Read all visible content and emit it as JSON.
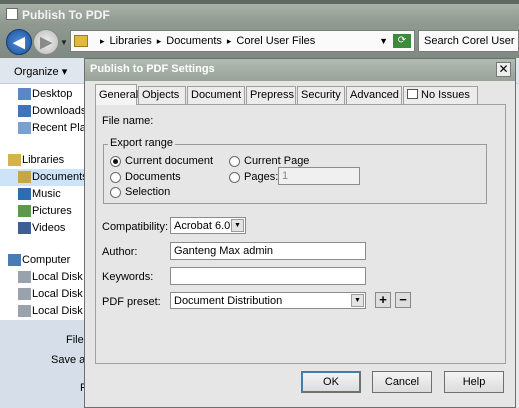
{
  "outer_window": {
    "title": "Publish To PDF",
    "address_path": [
      "Libraries",
      "Documents",
      "Corel User Files"
    ],
    "search_placeholder": "Search Corel User Files",
    "organize_label": "Organize",
    "nav_items": [
      {
        "label": "Desktop",
        "icon": "desktop-icon",
        "color": "#5b87c6"
      },
      {
        "label": "Downloads",
        "icon": "downloads-icon",
        "color": "#3f74b8"
      },
      {
        "label": "Recent Places",
        "icon": "recent-places-icon",
        "color": "#7aa0cf"
      },
      {
        "label": "Libraries",
        "icon": "libraries-icon",
        "color": "#d6b34a"
      },
      {
        "label": "Documents",
        "icon": "documents-icon",
        "color": "#c9a63f",
        "selected": true
      },
      {
        "label": "Music",
        "icon": "music-icon",
        "color": "#2f6db2"
      },
      {
        "label": "Pictures",
        "icon": "pictures-icon",
        "color": "#5a9a4a"
      },
      {
        "label": "Videos",
        "icon": "videos-icon",
        "color": "#3e5e9a"
      },
      {
        "label": "Computer",
        "icon": "computer-icon",
        "color": "#4b7bb5"
      },
      {
        "label": "Local Disk",
        "icon": "disk-icon",
        "color": "#9aa3ad"
      },
      {
        "label": "Local Disk",
        "icon": "disk-icon",
        "color": "#9aa3ad"
      },
      {
        "label": "Local Disk",
        "icon": "disk-icon",
        "color": "#9aa3ad"
      }
    ],
    "bottom_labels": [
      "File n",
      "Save as",
      "P"
    ]
  },
  "dialog": {
    "title": "Publish to PDF Settings",
    "close_glyph": "✕",
    "tabs": [
      "General",
      "Objects",
      "Document",
      "Prepress",
      "Security",
      "Advanced",
      "No Issues"
    ],
    "active_tab": "General",
    "file_name_label": "File name:",
    "export_range": {
      "legend": "Export range",
      "options": [
        {
          "label": "Current document",
          "checked": true
        },
        {
          "label": "Documents",
          "checked": false
        },
        {
          "label": "Selection",
          "checked": false
        },
        {
          "label": "Current Page",
          "checked": false
        },
        {
          "label": "Pages:",
          "checked": false
        }
      ],
      "pages_value": "1"
    },
    "compatibility": {
      "label": "Compatibility:",
      "value": "Acrobat 6.0"
    },
    "author": {
      "label": "Author:",
      "value": "Ganteng Max admin"
    },
    "keywords": {
      "label": "Keywords:",
      "value": ""
    },
    "pdf_preset": {
      "label": "PDF preset:",
      "value": "Document Distribution",
      "add_glyph": "+",
      "remove_glyph": "−"
    },
    "buttons": {
      "ok": "OK",
      "cancel": "Cancel",
      "help": "Help"
    }
  }
}
